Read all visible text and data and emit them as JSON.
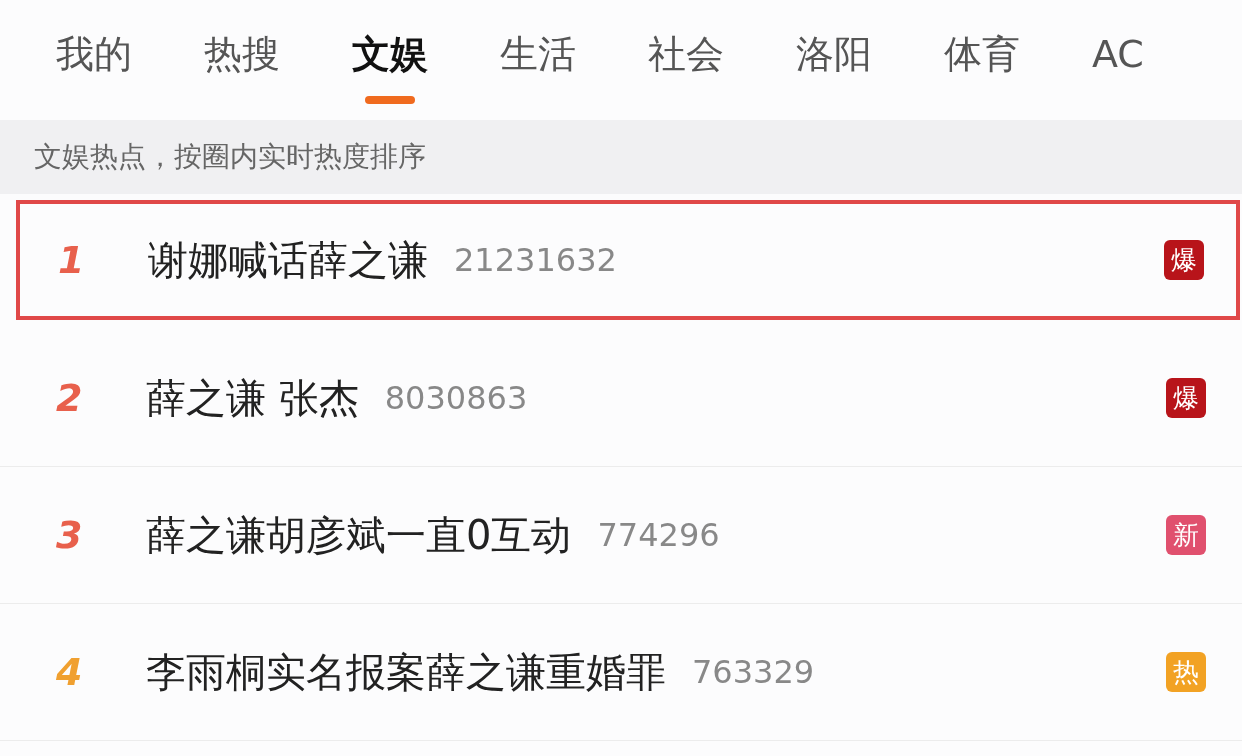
{
  "tabs": [
    {
      "label": "我的",
      "selected": false
    },
    {
      "label": "热搜",
      "selected": false
    },
    {
      "label": "文娱",
      "selected": true
    },
    {
      "label": "生活",
      "selected": false
    },
    {
      "label": "社会",
      "selected": false
    },
    {
      "label": "洛阳",
      "selected": false
    },
    {
      "label": "体育",
      "selected": false
    },
    {
      "label": "AC",
      "selected": false
    }
  ],
  "subtitle": "文娱热点，按圈内实时热度排序",
  "rows": [
    {
      "rank": {
        "text": "1",
        "color": "#e8604c"
      },
      "title": "谢娜喊话薛之谦",
      "count": "21231632",
      "badge": {
        "text": "爆",
        "color": "#b8141a"
      },
      "highlighted": true
    },
    {
      "rank": {
        "text": "2",
        "color": "#e8604c"
      },
      "title": "薛之谦 张杰",
      "count": "8030863",
      "badge": {
        "text": "爆",
        "color": "#b8141a"
      },
      "highlighted": false
    },
    {
      "rank": {
        "text": "3",
        "color": "#e8604c"
      },
      "title": "薛之谦胡彦斌一直0互动",
      "count": "774296",
      "badge": {
        "text": "新",
        "color": "#e0506e"
      },
      "highlighted": false
    },
    {
      "rank": {
        "text": "4",
        "color": "#f0a030"
      },
      "title": "李雨桐实名报案薛之谦重婚罪",
      "count": "763329",
      "badge": {
        "text": "热",
        "color": "#f2a224"
      },
      "highlighted": false
    }
  ]
}
